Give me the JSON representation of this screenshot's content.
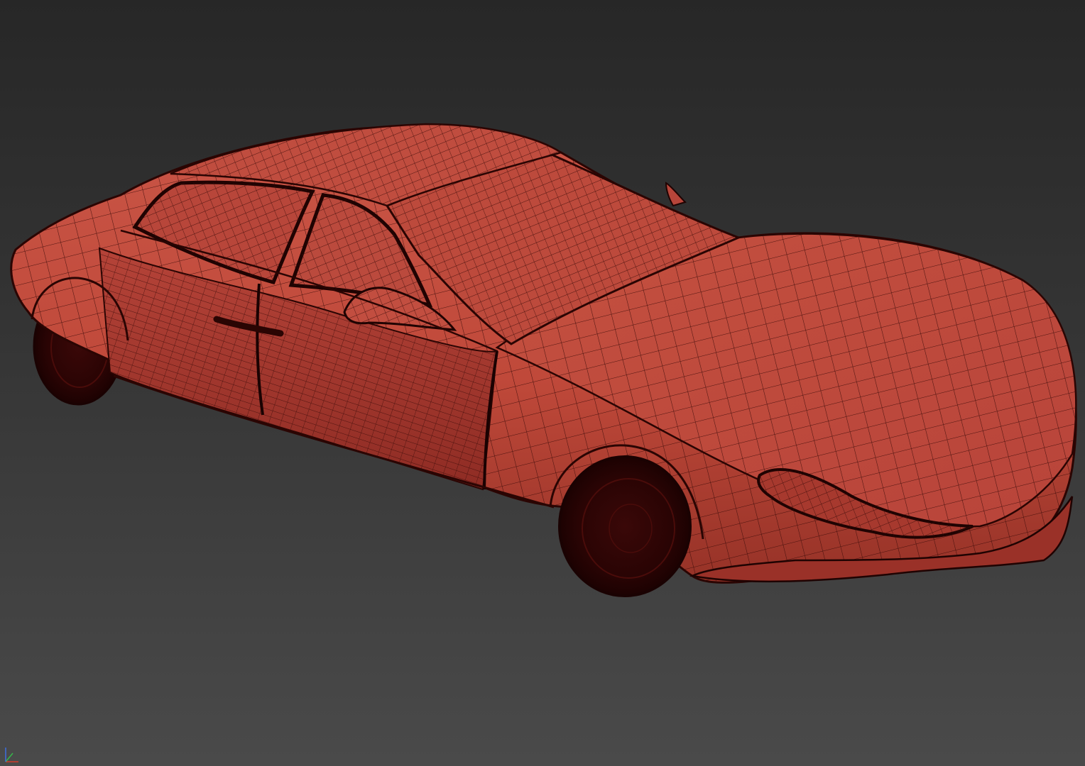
{
  "viewport": {
    "background_top": "#272727",
    "background_bottom": "#4a4a4a"
  },
  "model": {
    "name": "car-body-mesh",
    "shading_color": "#c0493a",
    "shading_dark": "#8e2a22",
    "wire_color": "#3a0a08",
    "tire_color": "#2e0606"
  },
  "gizmo": {
    "x_color": "#d23a2a",
    "y_color": "#36b84a",
    "z_color": "#3d6fe0"
  }
}
